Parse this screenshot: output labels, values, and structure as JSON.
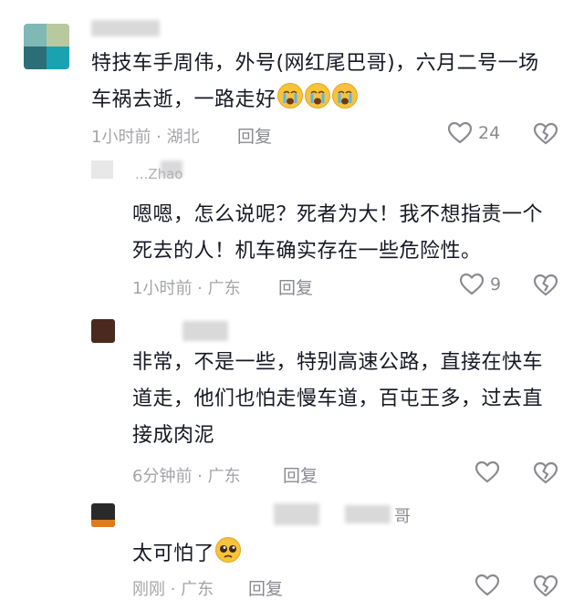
{
  "comments": [
    {
      "text": "特技车手周伟，外号(网红尾巴哥)，六月二号一场车祸去逝，一路走好",
      "emojis": [
        "crying-face",
        "crying-face",
        "crying-face"
      ],
      "time": "1小时前",
      "location": "湖北",
      "reply_label": "回复",
      "like_count": "24"
    },
    {
      "username": "...Zhao",
      "text": "嗯嗯，怎么说呢？死者为大！我不想指责一个死去的人！机车确实存在一些危险性。",
      "time": "1小时前",
      "location": "广东",
      "reply_label": "回复",
      "like_count": "9"
    },
    {
      "text": "非常，不是一些，特别高速公路，直接在快车道走，他们也怕走慢车道，百屯王多，过去直接成肉泥",
      "time": "6分钟前",
      "location": "广东",
      "reply_label": "回复",
      "like_count": ""
    },
    {
      "username": "哥",
      "text": "太可怕了",
      "emojis": [
        "pleading-face"
      ],
      "time": "刚刚",
      "location": "广东",
      "reply_label": "回复",
      "like_count": ""
    }
  ],
  "sep": " · "
}
